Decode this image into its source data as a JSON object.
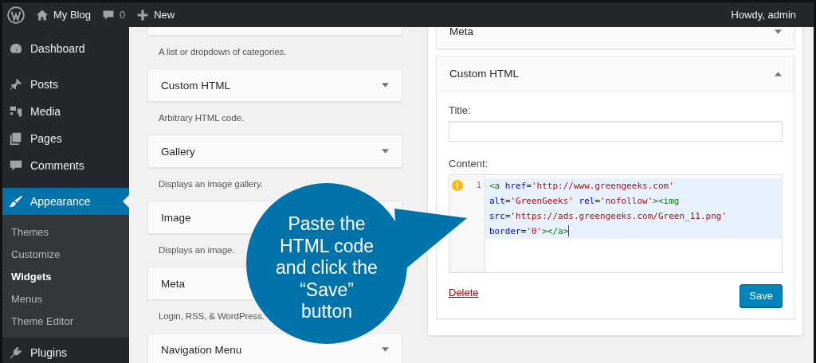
{
  "admin_bar": {
    "site_name": "My Blog",
    "comments_count": "0",
    "new_label": "New",
    "greeting": "Howdy, admin"
  },
  "sidebar": {
    "items": [
      {
        "label": "Dashboard",
        "selected": false
      },
      {
        "label": "Posts",
        "selected": false
      },
      {
        "label": "Media",
        "selected": false
      },
      {
        "label": "Pages",
        "selected": false
      },
      {
        "label": "Comments",
        "selected": false
      },
      {
        "label": "Appearance",
        "selected": true,
        "children": [
          {
            "label": "Themes",
            "selected": false
          },
          {
            "label": "Customize",
            "selected": false
          },
          {
            "label": "Widgets",
            "selected": true
          },
          {
            "label": "Menus",
            "selected": false
          },
          {
            "label": "Theme Editor",
            "selected": false
          }
        ]
      },
      {
        "label": "Plugins",
        "selected": false
      }
    ]
  },
  "available_widgets": [
    {
      "description": "A list or dropdown of categories."
    },
    {
      "title": "Custom HTML",
      "expanded": false,
      "description": "Arbitrary HTML code."
    },
    {
      "title": "Gallery",
      "expanded": false,
      "description": "Displays an image gallery."
    },
    {
      "title": "Image",
      "description": "Displays an image."
    },
    {
      "title": "Meta",
      "description": "Login, RSS, & WordPress."
    },
    {
      "title": "Navigation Menu",
      "expanded": false
    }
  ],
  "sidebar_widgets": [
    {
      "title": "Meta",
      "expanded": false
    },
    {
      "title": "Custom HTML",
      "expanded": true,
      "form": {
        "title_label": "Title:",
        "content_label": "Content:",
        "editor": {
          "warning": true,
          "line_number": "1",
          "lines": [
            [
              {
                "t": "<a",
                "kind": "tag"
              },
              {
                "t": " href",
                "kind": "attr"
              },
              {
                "t": "=",
                "kind": "plain"
              },
              {
                "t": "'http://www.greengeeks.com'",
                "kind": "string"
              }
            ],
            [
              {
                "t": "alt",
                "kind": "attr"
              },
              {
                "t": "=",
                "kind": "plain"
              },
              {
                "t": "'GreenGeeks'",
                "kind": "string"
              },
              {
                "t": " rel",
                "kind": "attr"
              },
              {
                "t": "=",
                "kind": "plain"
              },
              {
                "t": "'nofollow'",
                "kind": "string"
              },
              {
                "t": "><img",
                "kind": "tag"
              }
            ],
            [
              {
                "t": "src",
                "kind": "attr"
              },
              {
                "t": "=",
                "kind": "plain"
              },
              {
                "t": "'https://ads.greengeeks.com/Green_11.png'",
                "kind": "string"
              }
            ],
            [
              {
                "t": "border",
                "kind": "attr"
              },
              {
                "t": "=",
                "kind": "plain"
              },
              {
                "t": "'0'",
                "kind": "string"
              },
              {
                "t": "></a>",
                "kind": "tag"
              }
            ]
          ]
        },
        "delete_label": "Delete",
        "save_label": "Save"
      }
    }
  ],
  "callout": {
    "text": "Paste the HTML code and click the “Save” button"
  }
}
